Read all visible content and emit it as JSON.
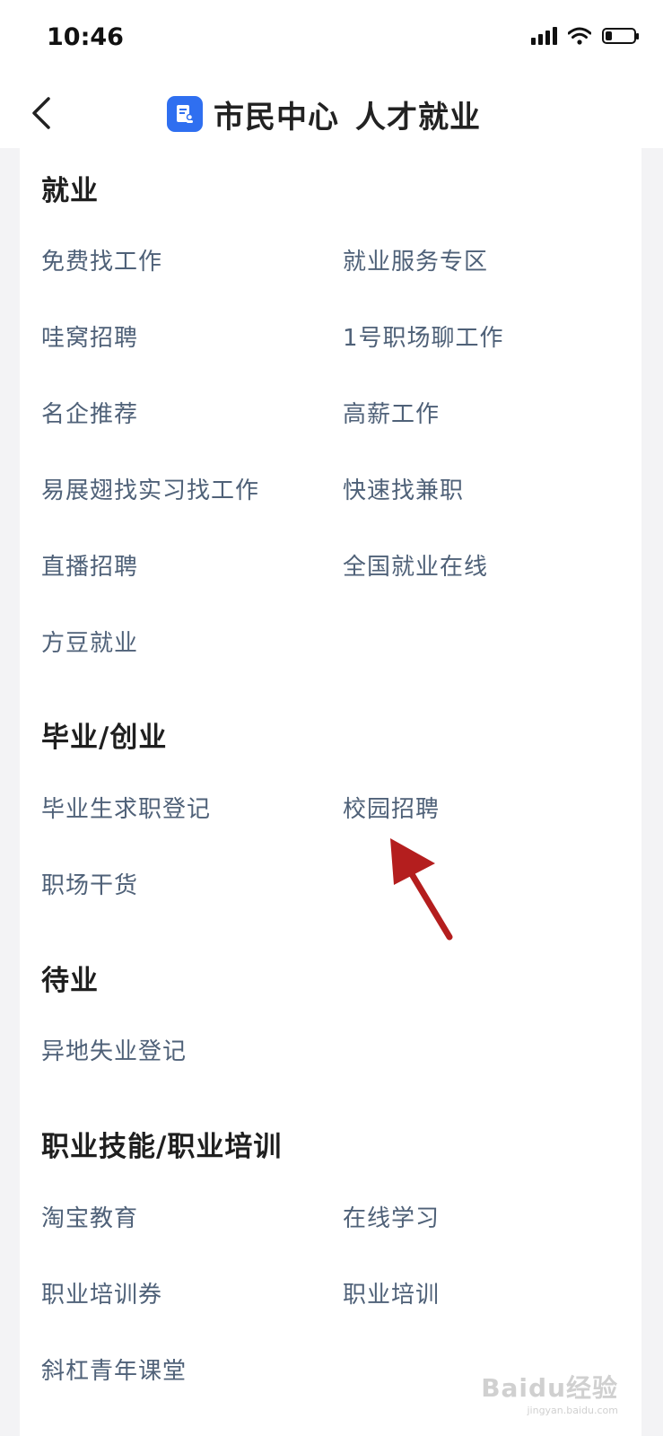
{
  "status_bar": {
    "time": "10:46"
  },
  "nav": {
    "title_part1": "市民中心",
    "title_part2": "人才就业"
  },
  "sections": {
    "employment": {
      "title": "就业",
      "items": [
        "免费找工作",
        "就业服务专区",
        "哇窝招聘",
        "1号职场聊工作",
        "名企推荐",
        "高薪工作",
        "易展翅找实习找工作",
        "快速找兼职",
        "直播招聘",
        "全国就业在线",
        "方豆就业"
      ]
    },
    "graduation": {
      "title": "毕业/创业",
      "items": [
        "毕业生求职登记",
        "校园招聘",
        "职场干货"
      ]
    },
    "unemployed": {
      "title": "待业",
      "items": [
        "异地失业登记"
      ]
    },
    "training": {
      "title": "职业技能/职业培训",
      "items": [
        "淘宝教育",
        "在线学习",
        "职业培训券",
        "职业培训",
        "斜杠青年课堂"
      ]
    }
  },
  "watermark": {
    "brand": "Baidu经验",
    "url": "jingyan.baidu.com"
  },
  "colors": {
    "link": "#4f6178",
    "logo": "#2f6ff0",
    "arrow": "#b41e1e"
  }
}
